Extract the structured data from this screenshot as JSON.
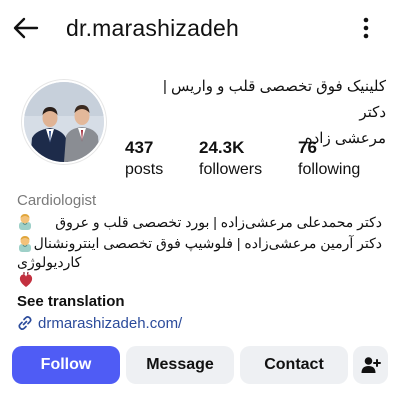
{
  "header": {
    "username": "dr.marashizadeh",
    "back_icon": "arrow-left-icon",
    "more_icon": "more-vertical-icon"
  },
  "profile": {
    "name_line1": "کلینیک فوق تخصصی قلب و واریس | دکتر",
    "name_line2": "مرعشی زاده"
  },
  "stats": [
    {
      "value": "437",
      "label": "posts"
    },
    {
      "value": "24.3K",
      "label": "followers"
    },
    {
      "value": "76",
      "label": "following"
    }
  ],
  "bio": {
    "category": "Cardiologist",
    "line1": "دکتر محمدعلی مرعشی‌زاده | بورد تخصصی قلب و عروق",
    "line2": "دکتر آرمین مرعشی‌زاده | فلوشیپ فوق تخصصی اینترونشنال",
    "line3": "کاردیولوژی",
    "see_translation": "See translation",
    "link": "drmarashizadeh.com/"
  },
  "buttons": {
    "follow": "Follow",
    "message": "Message",
    "contact": "Contact"
  },
  "colors": {
    "follow_button": "#4f5cf5",
    "secondary_button": "#eef0f3",
    "link": "#2b4b9b",
    "category_text": "#7a7a7a"
  }
}
